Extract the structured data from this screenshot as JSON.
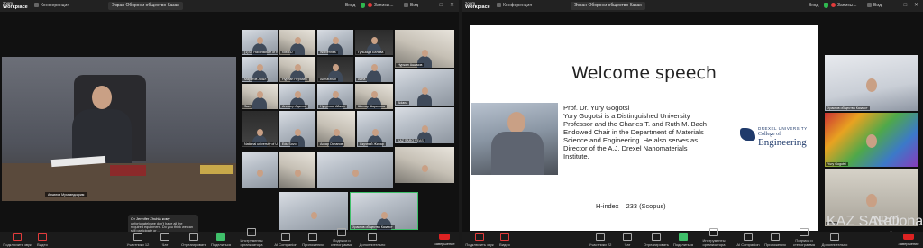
{
  "app": {
    "logo_line1": "zoom",
    "logo_line2": "Workplace"
  },
  "left": {
    "titlebar": {
      "conference_label": "Конференция",
      "tab_title": "Экран Оборони общество Казах",
      "sign_in": "Вход",
      "status": "Записы...",
      "view": "Вид"
    },
    "main_video_name": "Ахматов Мухамедкарим",
    "tiles": [
      {
        "name": "(1) 07 Hall Institute of Kazakhstan"
      },
      {
        "name": "NIMED"
      },
      {
        "name": "Wolverines"
      },
      {
        "name": "Гульзада Белова"
      },
      {
        "name": "Нуржан Ашимов"
      },
      {
        "name": "Маратов Асыл"
      },
      {
        "name": "Нурлан Нұрбаев"
      },
      {
        "name": "Akmarzhan"
      },
      {
        "name": "Анна"
      },
      {
        "name": "Aidana"
      },
      {
        "name": "Sam"
      },
      {
        "name": "Алишер Адилов"
      },
      {
        "name": "Нурулова Айжан"
      },
      {
        "name": "Шынар Шарипова"
      },
      {
        "name": "KAZ SARO VEAS"
      },
      {
        "name": "National university of Uzbekistan"
      },
      {
        "name": "Edu Sovo"
      },
      {
        "name": "Аскар Оспанов"
      },
      {
        "name": "Скучный Жирар"
      },
      {
        "name": "Храктов общества Казахст"
      }
    ],
    "chat": {
      "from": "От Jennifer Zhuhla кому",
      "text": "unfortunately we don't have all the required equipment. Do you think we can still participate or ..."
    },
    "toolbar": [
      {
        "label": "Подключить звук"
      },
      {
        "label": "Видео"
      },
      {
        "label": "Участники",
        "count": "12"
      },
      {
        "label": "Чат"
      },
      {
        "label": "Отреагировать"
      },
      {
        "label": "Поделиться"
      },
      {
        "label": "Инструменты организатора"
      },
      {
        "label": "AI Companion"
      },
      {
        "label": "Приложения"
      },
      {
        "label": "Подписи и стенограмма"
      },
      {
        "label": "Дополнительно"
      }
    ],
    "end_label": "Завершение"
  },
  "right": {
    "titlebar": {
      "conference_label": "Конференция",
      "tab_title": "Экран Оборони общество Казах",
      "sign_in": "Вход",
      "status": "Записы...",
      "view": "Вид"
    },
    "slide": {
      "title": "Welcome speech",
      "paragraph_lines": [
        "Prof. Dr. Yury Gogotsi",
        "Yury Gogotsi is a Distinguished University",
        "Professor and the Charles T. and Ruth M. Bach",
        "Endowed Chair in the Department of Materials",
        "Science and Engineering. He also serves as",
        "Director of the A.J. Drexel Nanomaterials",
        "Institute."
      ],
      "hindex": "H-index – 233 (Scopus)",
      "logo": {
        "line1": "DREXEL UNIVERSITY",
        "line2": "College of",
        "line3": "Engineering"
      }
    },
    "side_tiles": [
      {
        "name": "Храктов общества Казахст"
      },
      {
        "name": "Yury Gogotsi"
      },
      {
        "name": "audio"
      },
      {
        "name": "KAZ SARO"
      },
      {
        "name": "National univ"
      }
    ],
    "toolbar": [
      {
        "label": "Подключить звук"
      },
      {
        "label": "Видео"
      },
      {
        "label": "Участники",
        "count": "22"
      },
      {
        "label": "Чат"
      },
      {
        "label": "Отреагировать"
      },
      {
        "label": "Поделиться"
      },
      {
        "label": "Инструменты организатора"
      },
      {
        "label": "AI Companion"
      },
      {
        "label": "Приложения"
      },
      {
        "label": "Подписи и стенограмма"
      },
      {
        "label": "Дополнительно"
      }
    ],
    "end_label": "Завершение"
  },
  "colors": {
    "accent_green": "#3fc06a",
    "end_red": "#dd2222",
    "mute_red": "#e23b3b"
  }
}
